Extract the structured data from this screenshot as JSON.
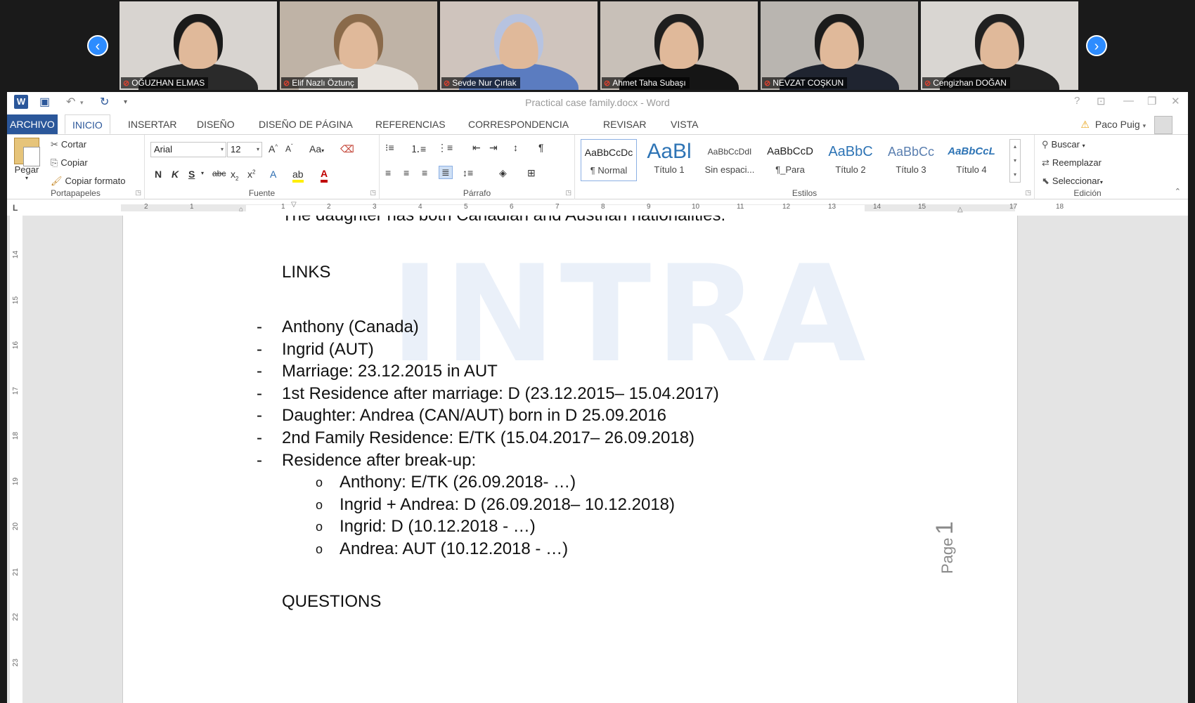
{
  "participants": [
    {
      "name": "OĞUZHAN ELMAS",
      "bg": "#d8d4d0",
      "hair": "#1a1a1a",
      "cloth": "#2a2a2a"
    },
    {
      "name": "Elif Nazlı Öztunç",
      "bg": "#bfb3a6",
      "hair": "#8a6a4a",
      "cloth": "#e8e4df"
    },
    {
      "name": "Sevde Nur Çırlak",
      "bg": "#cfc4bd",
      "hair": "#b7c3e0",
      "cloth": "#5b7cc0"
    },
    {
      "name": "Ahmet Taha Subaşı",
      "bg": "#c8c0b8",
      "hair": "#1e1e1e",
      "cloth": "#151515"
    },
    {
      "name": "NEVZAT COŞKUN",
      "bg": "#b9b5b0",
      "hair": "#1b1b1b",
      "cloth": "#1f2430"
    },
    {
      "name": "Cengizhan DOĞAN",
      "bg": "#d9d6d2",
      "hair": "#202020",
      "cloth": "#222222"
    }
  ],
  "window": {
    "title": "Practical case family.docx - Word",
    "user": "Paco Puig"
  },
  "tabs": [
    "ARCHIVO",
    "INICIO",
    "INSERTAR",
    "DISEÑO",
    "DISEÑO DE PÁGINA",
    "REFERENCIAS",
    "CORRESPONDENCIA",
    "REVISAR",
    "VISTA"
  ],
  "ribbon": {
    "clipboard": {
      "paste": "Pegar",
      "cut": "Cortar",
      "copy": "Copiar",
      "format_painter": "Copiar formato",
      "label": "Portapapeles"
    },
    "font": {
      "name": "Arial",
      "size": "12",
      "label": "Fuente"
    },
    "paragraph": {
      "label": "Párrafo"
    },
    "styles": {
      "label": "Estilos",
      "items": [
        {
          "preview": "AaBbCcDc",
          "name": "¶ Normal"
        },
        {
          "preview": "AaBl",
          "name": "Título 1"
        },
        {
          "preview": "AaBbCcDdI",
          "name": "Sin espaci..."
        },
        {
          "preview": "AaBbCcD",
          "name": "¶_Para"
        },
        {
          "preview": "AaBbC",
          "name": "Título 2"
        },
        {
          "preview": "AaBbCc",
          "name": "Título 3"
        },
        {
          "preview": "AaBbCcL",
          "name": "Título 4"
        }
      ]
    },
    "editing": {
      "find": "Buscar",
      "replace": "Reemplazar",
      "select": "Seleccionar",
      "label": "Edición"
    }
  },
  "ruler": {
    "h_labels": [
      "2",
      "1",
      "1",
      "2",
      "3",
      "4",
      "5",
      "6",
      "7",
      "8",
      "9",
      "10",
      "11",
      "12",
      "13",
      "14",
      "15",
      "17",
      "18"
    ],
    "v_labels": [
      "14",
      "15",
      "16",
      "17",
      "18",
      "19",
      "20",
      "21",
      "22",
      "23"
    ],
    "corner": "L"
  },
  "document": {
    "partial_line": "The daughter has both Canadian and Austrian nationalities.",
    "watermark": "INTRA",
    "links_heading": "LINKS",
    "links": [
      "Anthony (Canada)",
      "Ingrid (AUT)",
      "Marriage: 23.12.2015 in AUT",
      "1st Residence after marriage: D (23.12.2015– 15.04.2017)",
      "Daughter: Andrea (CAN/AUT) born in D 25.09.2016",
      "2nd Family Residence: E/TK (15.04.2017– 26.09.2018)",
      "Residence after break-up:"
    ],
    "sub_links": [
      "Anthony: E/TK (26.09.2018- …)",
      "Ingrid + Andrea: D (26.09.2018– 10.12.2018)",
      "Ingrid: D (10.12.2018 - …)",
      "Andrea: AUT (10.12.2018 - …)"
    ],
    "questions_heading": "QUESTIONS",
    "page_word": "Page",
    "page_number": "1"
  }
}
